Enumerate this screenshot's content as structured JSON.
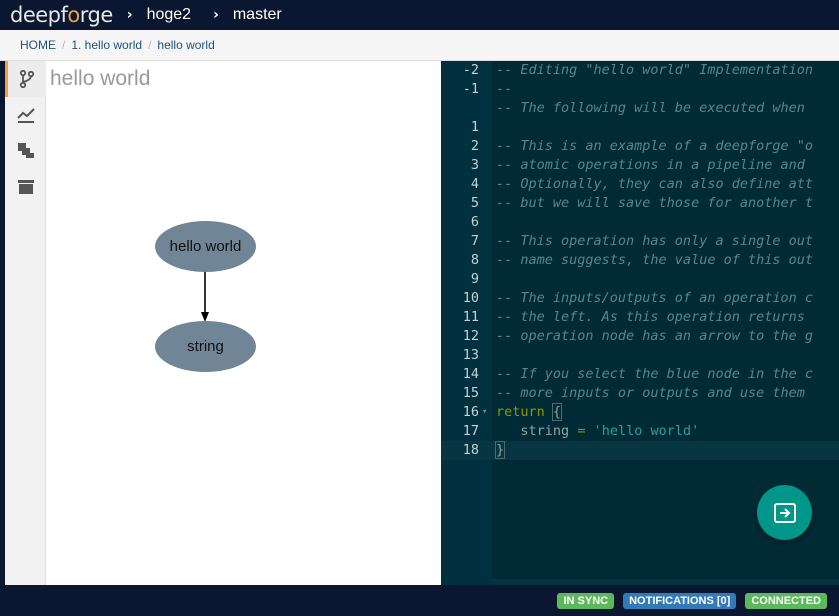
{
  "header": {
    "logo_pre": "deepf",
    "logo_mid": "o",
    "logo_post": "rge",
    "project": "hoge2",
    "branch": "master"
  },
  "breadcrumb": {
    "home": "HOME",
    "item1": "1. hello world",
    "item2": "hello world"
  },
  "sidebar": {
    "icons": [
      "branch-icon",
      "chart-line-icon",
      "layers-icon",
      "archive-icon"
    ]
  },
  "graph": {
    "title": "hello world",
    "nodes": [
      {
        "label": "hello world"
      },
      {
        "label": "string"
      }
    ]
  },
  "editor": {
    "lines": [
      {
        "num": "-2",
        "text": "-- Editing \"hello world\" Implementation"
      },
      {
        "num": "-1",
        "text": "--"
      },
      {
        "num": "",
        "text": "-- The following will be executed when"
      },
      {
        "num": "1",
        "text": ""
      },
      {
        "num": "2",
        "text": "-- This is an example of a deepforge \"o"
      },
      {
        "num": "3",
        "text": "-- atomic operations in a pipeline and"
      },
      {
        "num": "4",
        "text": "-- Optionally, they can also define att"
      },
      {
        "num": "5",
        "text": "-- but we will save those for another t"
      },
      {
        "num": "6",
        "text": ""
      },
      {
        "num": "7",
        "text": "-- This operation has only a single out"
      },
      {
        "num": "8",
        "text": "-- name suggests, the value of this out"
      },
      {
        "num": "9",
        "text": ""
      },
      {
        "num": "10",
        "text": "-- The inputs/outputs of an operation c"
      },
      {
        "num": "11",
        "text": "-- the left. As this operation returns"
      },
      {
        "num": "12",
        "text": "-- operation node has an arrow to the g"
      },
      {
        "num": "13",
        "text": ""
      },
      {
        "num": "14",
        "text": "-- If you select the blue node in the c"
      },
      {
        "num": "15",
        "text": "-- more inputs or outputs and use them"
      }
    ],
    "line16_num": "16",
    "line16_kw": "return",
    "line16_brace": "{",
    "line17_num": "17",
    "line17_var": "string",
    "line17_op": "=",
    "line17_str": "'hello world'",
    "line18_num": "18",
    "line18_brace": "}"
  },
  "fab": {
    "icon": "exit-to-app-icon"
  },
  "status": {
    "sync": "IN SYNC",
    "notifications": "NOTIFICATIONS [0]",
    "connection": "CONNECTED"
  },
  "colors": {
    "topbar": "#0b1730",
    "editor_bg": "#002b36",
    "node_fill": "#708595",
    "fab": "#00968a",
    "accent": "#f0a040"
  }
}
